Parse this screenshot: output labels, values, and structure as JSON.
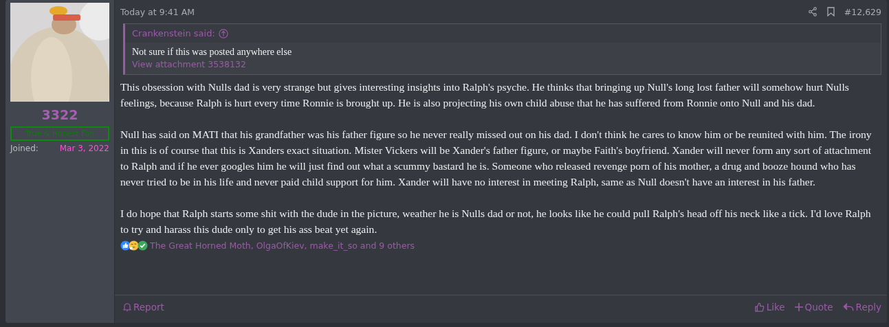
{
  "user": {
    "name": "3322",
    "title": "True & Honest Fan",
    "joined_label": "Joined:",
    "joined_date": "Mar 3, 2022"
  },
  "post": {
    "time": "Today at 9:41 AM",
    "number": "#12,629",
    "quote": {
      "author": "Crankenstein said:",
      "text": "Not sure if this was posted anywhere else",
      "link": "View attachment 3538132"
    },
    "paragraphs": [
      "This obsession with Nulls dad is very strange but gives interesting insights into Ralph's psyche. He thinks that bringing up Null's long lost father will somehow hurt Nulls feelings, because Ralph is hurt every time Ronnie is brought up. He is also projecting his own child abuse that he has suffered from Ronnie onto Null and his dad.",
      "Null has said on MATI that his grandfather was his father figure so he never really missed out on his dad. I don't think he cares to know him or be reunited with him. The irony in this is of course that this is Xanders exact situation. Mister Vickers will be Xander's father figure, or maybe Faith's boyfriend. Xander will never form any sort of attachment to Ralph and if he ever googles him he will just find out what a scummy bastard he is. Someone who released revenge porn of his mother, a drug and booze hound who has never tried to be in his life and never paid child support for him. Xander will have no interest in meeting Ralph, same as Null doesn't have an interest in his father.",
      "I do hope that Ralph starts some shit with the dude in the picture, weather he is Nulls dad or not, he looks like he could pull Ralph's head off his neck like a tick. I'd love Ralph to try and harass this dude only to get his ass beat yet again."
    ],
    "reactions": {
      "icons": [
        {
          "kind": "like"
        },
        {
          "kind": "thinking"
        },
        {
          "kind": "check"
        }
      ],
      "text": "The Great Horned Moth, OlgaOfKiev, make_it_so and 9 others"
    },
    "report": "Report",
    "actions": [
      {
        "kind": "like",
        "label": "Like"
      },
      {
        "kind": "quote",
        "label": "Quote"
      },
      {
        "kind": "reply",
        "label": "Reply"
      }
    ]
  }
}
